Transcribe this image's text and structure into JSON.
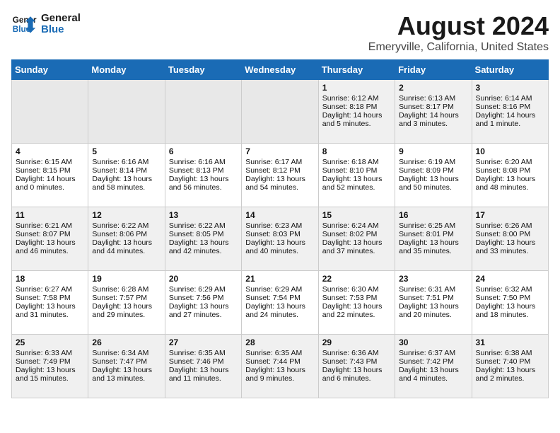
{
  "logo": {
    "line1": "General",
    "line2": "Blue"
  },
  "title": "August 2024",
  "subtitle": "Emeryville, California, United States",
  "days_of_week": [
    "Sunday",
    "Monday",
    "Tuesday",
    "Wednesday",
    "Thursday",
    "Friday",
    "Saturday"
  ],
  "weeks": [
    [
      {
        "day": "",
        "content": ""
      },
      {
        "day": "",
        "content": ""
      },
      {
        "day": "",
        "content": ""
      },
      {
        "day": "",
        "content": ""
      },
      {
        "day": "1",
        "content": "Sunrise: 6:12 AM\nSunset: 8:18 PM\nDaylight: 14 hours\nand 5 minutes."
      },
      {
        "day": "2",
        "content": "Sunrise: 6:13 AM\nSunset: 8:17 PM\nDaylight: 14 hours\nand 3 minutes."
      },
      {
        "day": "3",
        "content": "Sunrise: 6:14 AM\nSunset: 8:16 PM\nDaylight: 14 hours\nand 1 minute."
      }
    ],
    [
      {
        "day": "4",
        "content": "Sunrise: 6:15 AM\nSunset: 8:15 PM\nDaylight: 14 hours\nand 0 minutes."
      },
      {
        "day": "5",
        "content": "Sunrise: 6:16 AM\nSunset: 8:14 PM\nDaylight: 13 hours\nand 58 minutes."
      },
      {
        "day": "6",
        "content": "Sunrise: 6:16 AM\nSunset: 8:13 PM\nDaylight: 13 hours\nand 56 minutes."
      },
      {
        "day": "7",
        "content": "Sunrise: 6:17 AM\nSunset: 8:12 PM\nDaylight: 13 hours\nand 54 minutes."
      },
      {
        "day": "8",
        "content": "Sunrise: 6:18 AM\nSunset: 8:10 PM\nDaylight: 13 hours\nand 52 minutes."
      },
      {
        "day": "9",
        "content": "Sunrise: 6:19 AM\nSunset: 8:09 PM\nDaylight: 13 hours\nand 50 minutes."
      },
      {
        "day": "10",
        "content": "Sunrise: 6:20 AM\nSunset: 8:08 PM\nDaylight: 13 hours\nand 48 minutes."
      }
    ],
    [
      {
        "day": "11",
        "content": "Sunrise: 6:21 AM\nSunset: 8:07 PM\nDaylight: 13 hours\nand 46 minutes."
      },
      {
        "day": "12",
        "content": "Sunrise: 6:22 AM\nSunset: 8:06 PM\nDaylight: 13 hours\nand 44 minutes."
      },
      {
        "day": "13",
        "content": "Sunrise: 6:22 AM\nSunset: 8:05 PM\nDaylight: 13 hours\nand 42 minutes."
      },
      {
        "day": "14",
        "content": "Sunrise: 6:23 AM\nSunset: 8:03 PM\nDaylight: 13 hours\nand 40 minutes."
      },
      {
        "day": "15",
        "content": "Sunrise: 6:24 AM\nSunset: 8:02 PM\nDaylight: 13 hours\nand 37 minutes."
      },
      {
        "day": "16",
        "content": "Sunrise: 6:25 AM\nSunset: 8:01 PM\nDaylight: 13 hours\nand 35 minutes."
      },
      {
        "day": "17",
        "content": "Sunrise: 6:26 AM\nSunset: 8:00 PM\nDaylight: 13 hours\nand 33 minutes."
      }
    ],
    [
      {
        "day": "18",
        "content": "Sunrise: 6:27 AM\nSunset: 7:58 PM\nDaylight: 13 hours\nand 31 minutes."
      },
      {
        "day": "19",
        "content": "Sunrise: 6:28 AM\nSunset: 7:57 PM\nDaylight: 13 hours\nand 29 minutes."
      },
      {
        "day": "20",
        "content": "Sunrise: 6:29 AM\nSunset: 7:56 PM\nDaylight: 13 hours\nand 27 minutes."
      },
      {
        "day": "21",
        "content": "Sunrise: 6:29 AM\nSunset: 7:54 PM\nDaylight: 13 hours\nand 24 minutes."
      },
      {
        "day": "22",
        "content": "Sunrise: 6:30 AM\nSunset: 7:53 PM\nDaylight: 13 hours\nand 22 minutes."
      },
      {
        "day": "23",
        "content": "Sunrise: 6:31 AM\nSunset: 7:51 PM\nDaylight: 13 hours\nand 20 minutes."
      },
      {
        "day": "24",
        "content": "Sunrise: 6:32 AM\nSunset: 7:50 PM\nDaylight: 13 hours\nand 18 minutes."
      }
    ],
    [
      {
        "day": "25",
        "content": "Sunrise: 6:33 AM\nSunset: 7:49 PM\nDaylight: 13 hours\nand 15 minutes."
      },
      {
        "day": "26",
        "content": "Sunrise: 6:34 AM\nSunset: 7:47 PM\nDaylight: 13 hours\nand 13 minutes."
      },
      {
        "day": "27",
        "content": "Sunrise: 6:35 AM\nSunset: 7:46 PM\nDaylight: 13 hours\nand 11 minutes."
      },
      {
        "day": "28",
        "content": "Sunrise: 6:35 AM\nSunset: 7:44 PM\nDaylight: 13 hours\nand 9 minutes."
      },
      {
        "day": "29",
        "content": "Sunrise: 6:36 AM\nSunset: 7:43 PM\nDaylight: 13 hours\nand 6 minutes."
      },
      {
        "day": "30",
        "content": "Sunrise: 6:37 AM\nSunset: 7:42 PM\nDaylight: 13 hours\nand 4 minutes."
      },
      {
        "day": "31",
        "content": "Sunrise: 6:38 AM\nSunset: 7:40 PM\nDaylight: 13 hours\nand 2 minutes."
      }
    ]
  ]
}
